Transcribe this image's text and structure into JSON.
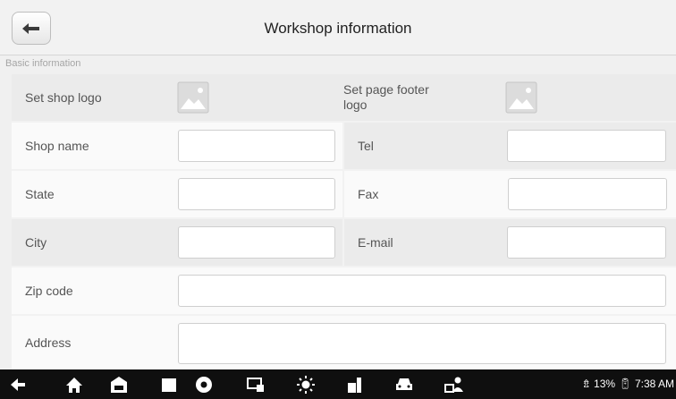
{
  "header": {
    "title": "Workshop information",
    "back_icon": "arrow-left-icon"
  },
  "section": {
    "label": "Basic information"
  },
  "form": {
    "logo_row": {
      "shop_logo_label": "Set shop logo",
      "footer_logo_label_line1": "Set page footer",
      "footer_logo_label_line2": "logo"
    },
    "shop_name": {
      "label": "Shop name",
      "value": ""
    },
    "tel": {
      "label": "Tel",
      "value": ""
    },
    "state": {
      "label": "State",
      "value": ""
    },
    "fax": {
      "label": "Fax",
      "value": ""
    },
    "city": {
      "label": "City",
      "value": ""
    },
    "email": {
      "label": "E-mail",
      "value": ""
    },
    "zip": {
      "label": "Zip code",
      "value": ""
    },
    "address": {
      "label": "Address",
      "value": ""
    }
  },
  "navbar": {
    "icons": [
      "back-icon",
      "home-icon",
      "car-garage-icon",
      "recent-apps-icon",
      "browser-icon",
      "screen-mirror-icon",
      "brightness-icon",
      "vci-icon",
      "vehicle-icon",
      "remote-expert-icon"
    ],
    "status": {
      "wifi_icon": "wifi-icon",
      "battery_percent": "13%",
      "time": "7:38 AM"
    }
  },
  "colors": {
    "nav_bg": "#0f0f0f",
    "header_bg": "#f2f2f2",
    "row_light": "#fafafa",
    "row_dark": "#ebebeb"
  }
}
